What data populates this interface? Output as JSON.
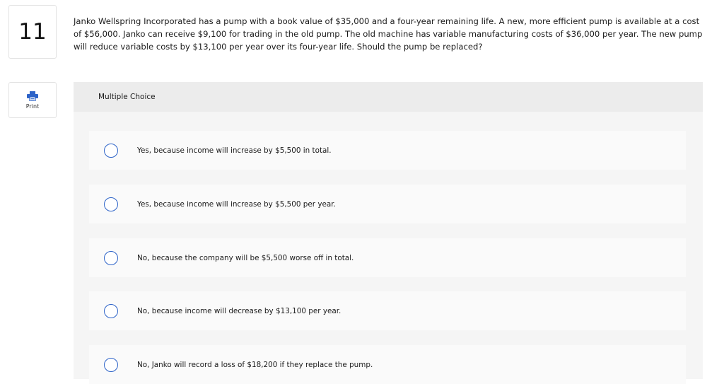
{
  "question": {
    "number": "11",
    "text": "Janko Wellspring Incorporated has a pump with a book value of $35,000 and a four-year remaining life. A new, more efficient pump is available at a cost of $56,000. Janko can receive $9,100 for trading in the old pump. The old machine has variable manufacturing costs of $36,000 per year. The new pump will reduce variable costs by $13,100 per year over its four-year life. Should the pump be replaced?"
  },
  "print": {
    "label": "Print",
    "icon": "printer-icon",
    "icon_color": "#2d63c8"
  },
  "choices": {
    "header": "Multiple Choice",
    "options": [
      {
        "label": "Yes, because income will increase by $5,500 in total."
      },
      {
        "label": "Yes, because income will increase by $5,500 per year."
      },
      {
        "label": "No, because the company will be $5,500 worse off in total."
      },
      {
        "label": "No, because income will decrease by $13,100 per year."
      },
      {
        "label": "No, Janko will record a loss of $18,200 if they replace the pump."
      }
    ]
  },
  "colors": {
    "radio_border": "#2d63c8",
    "panel_bg": "#f5f5f5",
    "header_bg": "#ececec",
    "option_bg": "#fafafa"
  }
}
